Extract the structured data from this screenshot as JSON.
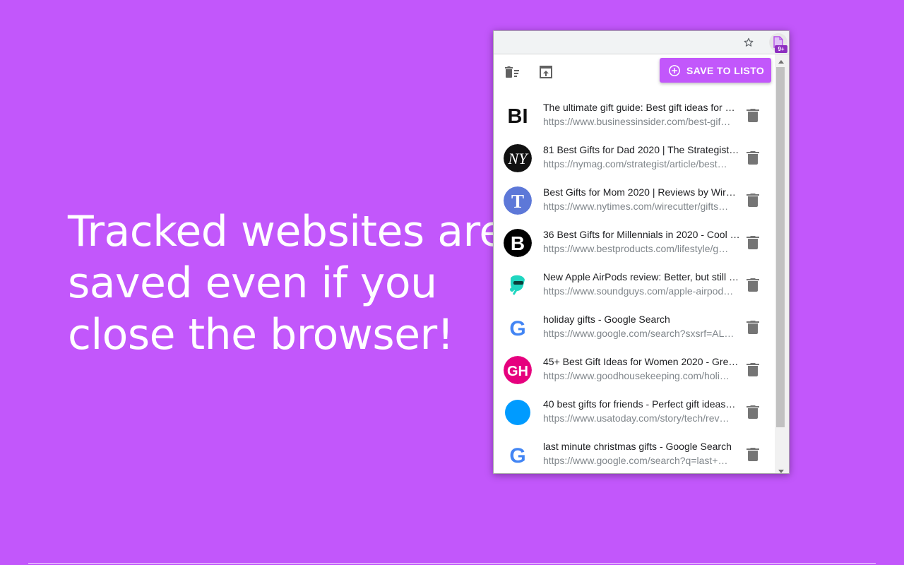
{
  "headline": {
    "line1": "Tracked websites are",
    "line2": "saved even if you",
    "line3": "close the browser!"
  },
  "extension": {
    "badge": "9+"
  },
  "popup": {
    "save_label": "SAVE TO LISTO",
    "accent_color": "#c257fb",
    "items": [
      {
        "title": "The ultimate gift guide: Best gift ideas for …",
        "url": "https://www.businessinsider.com/best-gif…",
        "icon": "business-insider-logo",
        "icon_text": "BI"
      },
      {
        "title": "81 Best Gifts for Dad 2020 | The Strategist…",
        "url": "https://nymag.com/strategist/article/best…",
        "icon": "nymag-logo",
        "icon_text": "NY"
      },
      {
        "title": "Best Gifts for Mom 2020 | Reviews by Wire…",
        "url": "https://www.nytimes.com/wirecutter/gifts…",
        "icon": "nytimes-logo",
        "icon_text": "T"
      },
      {
        "title": "36 Best Gifts for Millennials in 2020 - Cool …",
        "url": "https://www.bestproducts.com/lifestyle/g…",
        "icon": "bestproducts-logo",
        "icon_text": "B"
      },
      {
        "title": "New Apple AirPods review: Better, but still …",
        "url": "https://www.soundguys.com/apple-airpod…",
        "icon": "soundguys-logo",
        "icon_text": ""
      },
      {
        "title": "holiday gifts - Google Search",
        "url": "https://www.google.com/search?sxsrf=AL…",
        "icon": "google-logo",
        "icon_text": "G"
      },
      {
        "title": "45+ Best Gift Ideas for Women 2020 - Gre…",
        "url": "https://www.goodhousekeeping.com/holi…",
        "icon": "goodhousekeeping-logo",
        "icon_text": "GH"
      },
      {
        "title": "40 best gifts for friends - Perfect gift ideas…",
        "url": "https://www.usatoday.com/story/tech/rev…",
        "icon": "usatoday-logo",
        "icon_text": ""
      },
      {
        "title": "last minute christmas gifts - Google Search",
        "url": "https://www.google.com/search?q=last+…",
        "icon": "google-logo",
        "icon_text": "G"
      }
    ]
  }
}
